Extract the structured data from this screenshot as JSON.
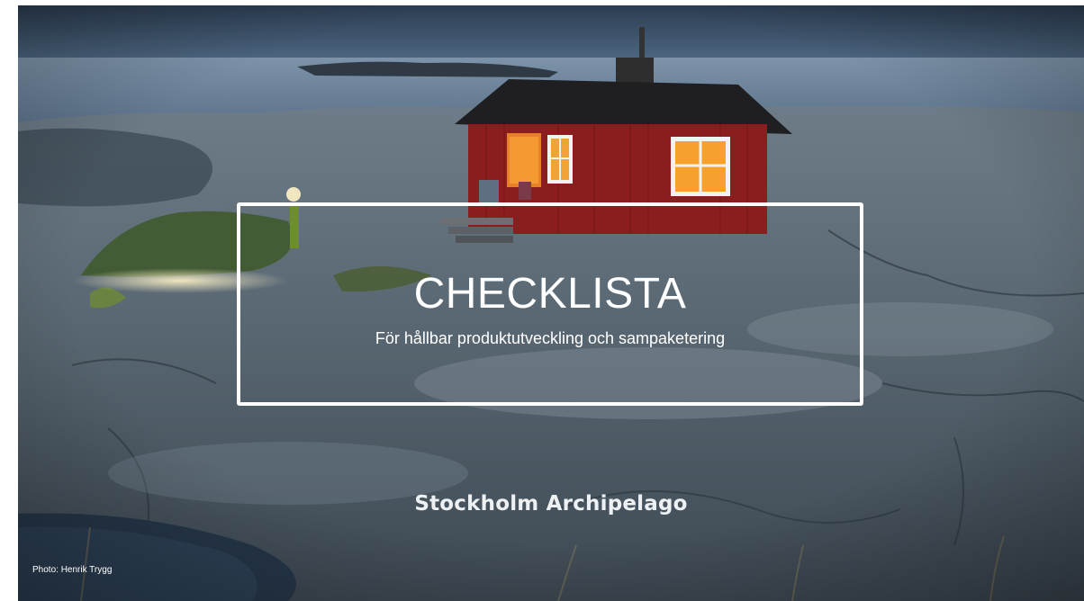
{
  "slide": {
    "title": "CHECKLISTA",
    "subtitle": "För hållbar produktutveckling  och sampaketering",
    "brand": "Stockholm Archipelago",
    "photo_credit": "Photo: Henrik Trygg"
  },
  "colors": {
    "text": "#ffffff",
    "frame": "#ffffff",
    "cabin_red": "#8a1d1d",
    "sea": "#6f859c",
    "rock": "#4c5a66"
  }
}
